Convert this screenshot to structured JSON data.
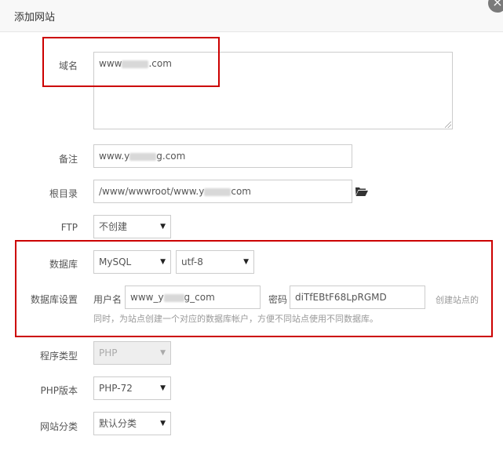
{
  "dialog": {
    "title": "添加网站",
    "close_icon": "×"
  },
  "form": {
    "domain": {
      "label": "域名",
      "value_prefix": "www",
      "value_suffix": ".com"
    },
    "remark": {
      "label": "备注",
      "value_prefix": "www.y",
      "value_suffix": "g.com"
    },
    "root_dir": {
      "label": "根目录",
      "value_prefix": "/www/wwwroot/www.y",
      "value_suffix": "com",
      "icon": "folder-open-icon"
    },
    "ftp": {
      "label": "FTP",
      "selected": "不创建"
    },
    "database": {
      "label": "数据库",
      "type_selected": "MySQL",
      "charset_selected": "utf-8"
    },
    "db_settings": {
      "label": "数据库设置",
      "username_label": "用户名",
      "username_prefix": "www_y",
      "username_suffix": "g_com",
      "password_label": "密码",
      "password_value": "diTfEBtF68LpRGMD",
      "help_line1": "创建站点的",
      "help_line2": "同时，为站点创建一个对应的数据库帐户，方便不同站点使用不同数据库。"
    },
    "program_type": {
      "label": "程序类型",
      "selected": "PHP"
    },
    "php_version": {
      "label": "PHP版本",
      "selected": "PHP-72"
    },
    "site_category": {
      "label": "网站分类",
      "selected": "默认分类"
    }
  },
  "colors": {
    "highlight": "#cc0000",
    "header_bg": "#f8f8f8"
  }
}
